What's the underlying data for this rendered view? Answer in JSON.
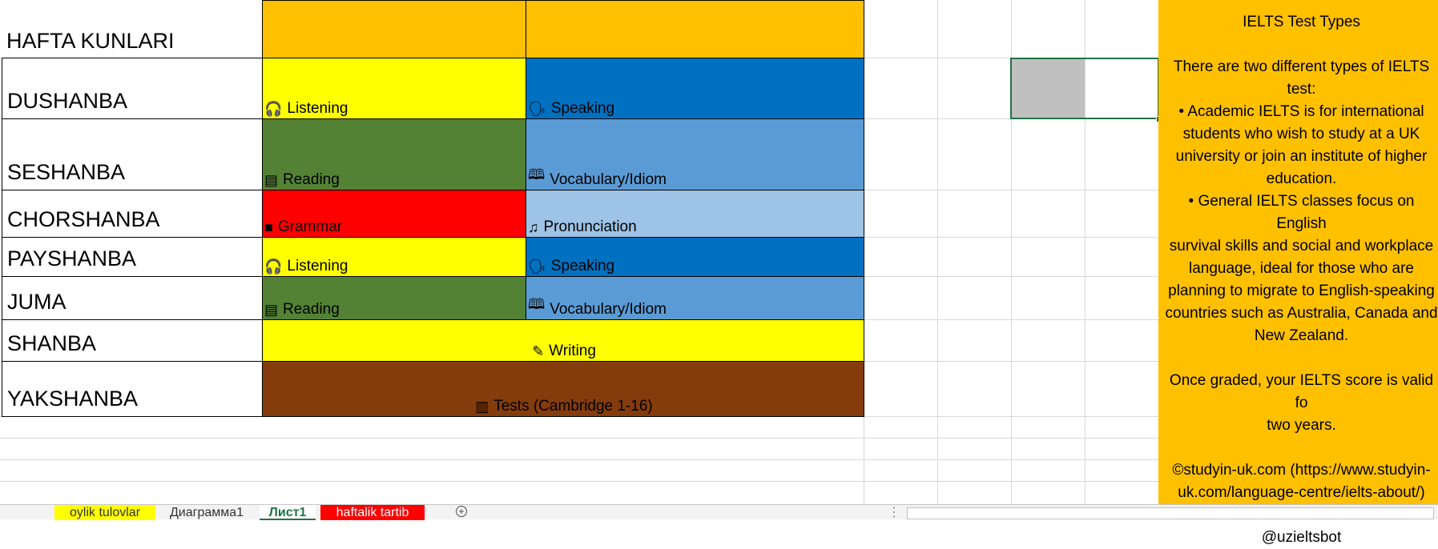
{
  "header": {
    "label": "HAFTA KUNLARI"
  },
  "days": [
    {
      "name": "DUSHANBA",
      "a1": {
        "icon": "🎧",
        "label": "Listening",
        "bg": "#ffff00"
      },
      "a2": {
        "icon": "🗣",
        "label": "Speaking",
        "bg": "#0070c0"
      }
    },
    {
      "name": "SESHANBA",
      "a1": {
        "icon": "▤",
        "label": "Reading",
        "bg": "#548235"
      },
      "a2": {
        "icon": "🕮",
        "label": "Vocabulary/Idiom",
        "bg": "#5b9bd5"
      }
    },
    {
      "name": "CHORSHANBA",
      "a1": {
        "icon": "■",
        "label": "Grammar",
        "bg": "#ff0000"
      },
      "a2": {
        "icon": "♫",
        "label": "Pronunciation",
        "bg": "#9dc3e6"
      }
    },
    {
      "name": "PAYSHANBA",
      "a1": {
        "icon": "🎧",
        "label": "Listening",
        "bg": "#ffff00"
      },
      "a2": {
        "icon": "🗣",
        "label": "Speaking",
        "bg": "#0070c0"
      }
    },
    {
      "name": "JUMA",
      "a1": {
        "icon": "▤",
        "label": "Reading",
        "bg": "#548235"
      },
      "a2": {
        "icon": "🕮",
        "label": "Vocabulary/Idiom",
        "bg": "#5b9bd5"
      }
    },
    {
      "name": "SHANBA",
      "full": {
        "icon": "✎",
        "label": "Writing",
        "bg": "#ffff00"
      }
    },
    {
      "name": "YAKSHANBA",
      "full": {
        "icon": "▥",
        "label": "Tests (Cambridge 1-16)",
        "bg": "#843c0c"
      }
    }
  ],
  "colors": {
    "header_bg": "#ffc000",
    "info_bg": "#ffc000",
    "selected_cell_bg": "#c0c0c0",
    "selection_border": "#217346"
  },
  "info": {
    "title": "IELTS Test Types",
    "intro1": "There are two different types of IELTS",
    "intro2": "test:",
    "b1_1": "• Academic IELTS is for international",
    "b1_2": "students who wish to study at a UK",
    "b1_3": "university or join an institute of higher",
    "b1_4": "education.",
    "b2_1": "• General IELTS classes focus on English",
    "b2_2": "survival skills and social and workplace",
    "b2_3": "language, ideal for those who are",
    "b2_4": "planning to migrate to English-speaking",
    "b2_5": "countries such as Australia, Canada and",
    "b2_6": "New Zealand.",
    "valid1": "Once graded, your IELTS score is valid fo",
    "valid2": "two years.",
    "src1": "©studyin-uk.com (https://www.studyin-",
    "src2": "uk.com/language-centre/ielts-about/)",
    "bot": "@uzieltsbot"
  },
  "sheet_tabs": [
    {
      "label": "oylik tulovlar",
      "bg": "#ffff00",
      "active": false
    },
    {
      "label": "Диаграмма1",
      "bg": "#f3f3f3",
      "active": false
    },
    {
      "label": "Лист1",
      "bg": "#ffffff",
      "active": true
    },
    {
      "label": "haftalik tartib",
      "bg": "#ff0000",
      "active": false
    }
  ],
  "add_sheet_icon": "plus-circle-icon"
}
